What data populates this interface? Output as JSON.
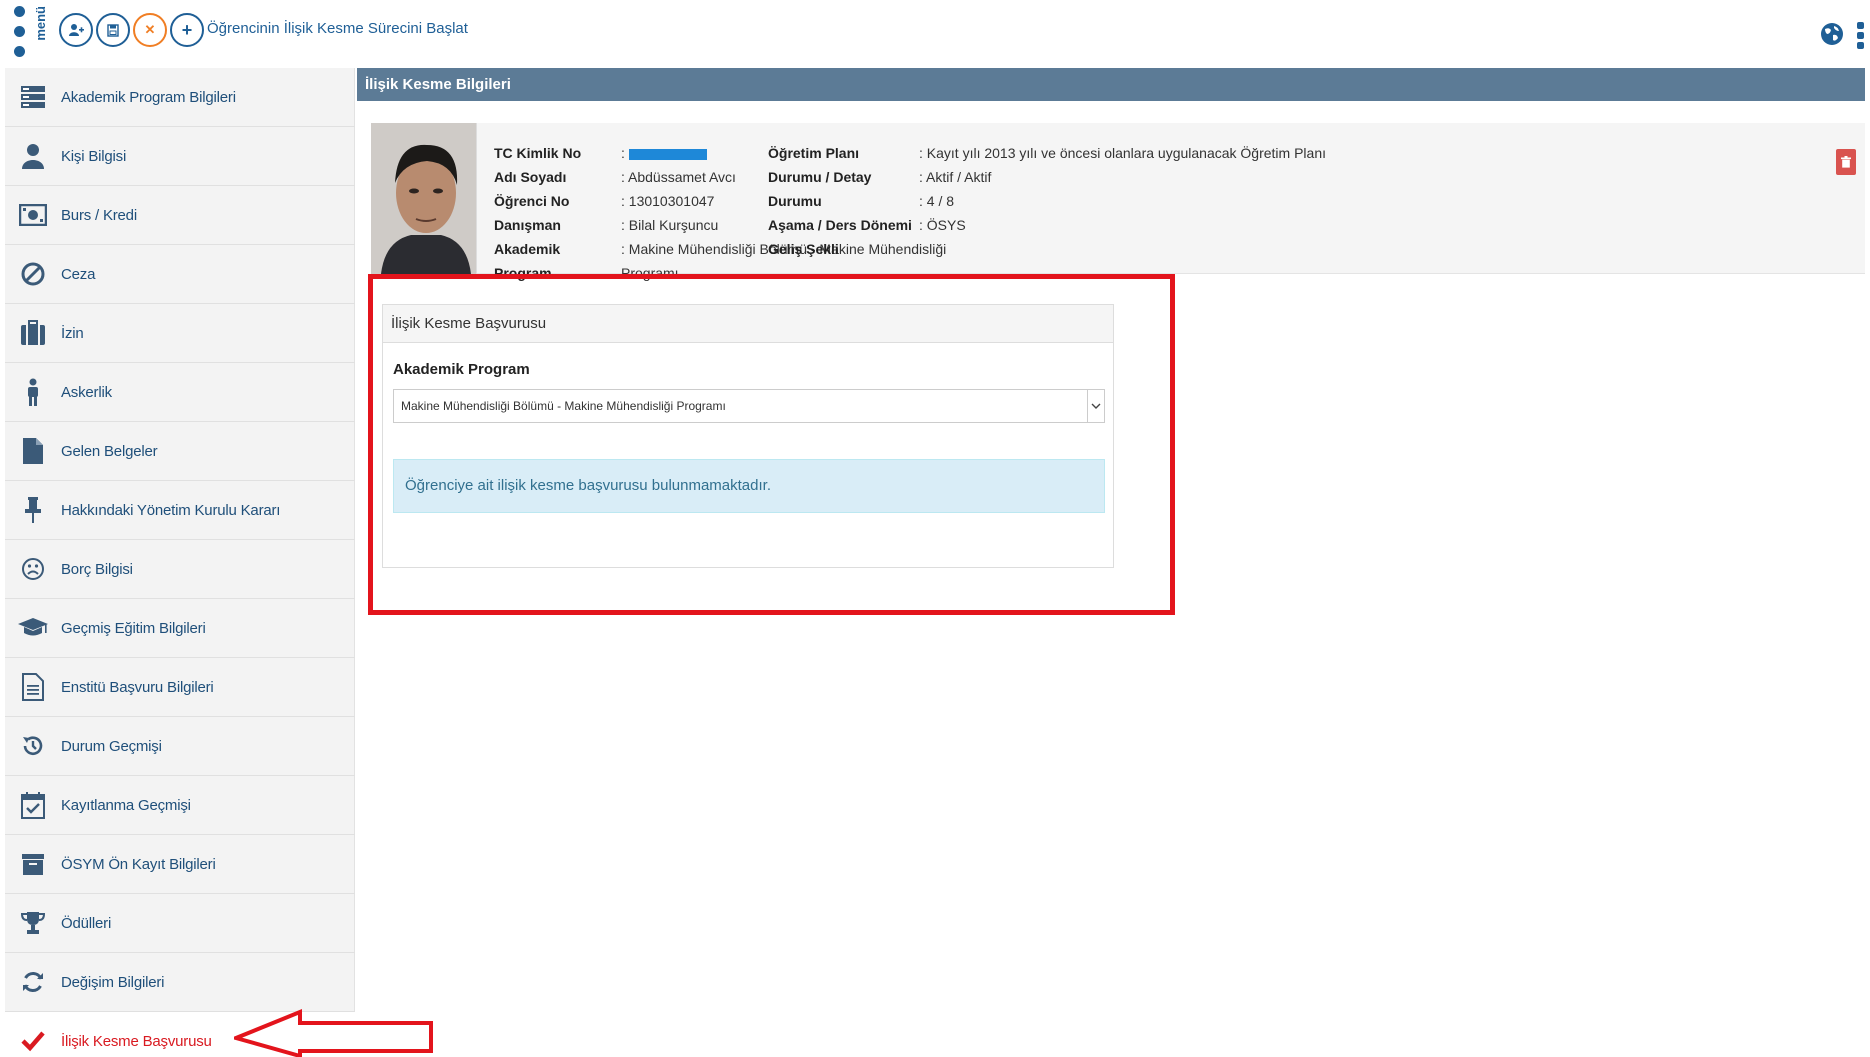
{
  "topbar": {
    "menu_word": "menü",
    "action_label": "Öğrencinin İlişik Kesme Sürecini Başlat",
    "buttons": [
      {
        "icon": "add-user-icon"
      },
      {
        "icon": "save-icon"
      },
      {
        "icon": "close-icon"
      },
      {
        "icon": "plus-icon"
      }
    ]
  },
  "sidebar": {
    "items": [
      {
        "label": "Akademik Program Bilgileri",
        "icon": "program-icon"
      },
      {
        "label": "Kişi Bilgisi",
        "icon": "person-icon"
      },
      {
        "label": "Burs / Kredi",
        "icon": "money-icon"
      },
      {
        "label": "Ceza",
        "icon": "ban-icon"
      },
      {
        "label": "İzin",
        "icon": "suitcase-icon"
      },
      {
        "label": "Askerlik",
        "icon": "soldier-icon"
      },
      {
        "label": "Gelen Belgeler",
        "icon": "file-icon"
      },
      {
        "label": "Hakkındaki Yönetim Kurulu Kararı",
        "icon": "pin-icon"
      },
      {
        "label": "Borç Bilgisi",
        "icon": "frown-icon"
      },
      {
        "label": "Geçmiş Eğitim Bilgileri",
        "icon": "graduation-cap-icon"
      },
      {
        "label": "Enstitü Başvuru Bilgileri",
        "icon": "document-icon"
      },
      {
        "label": "Durum Geçmişi",
        "icon": "history-icon"
      },
      {
        "label": "Kayıtlanma Geçmişi",
        "icon": "calendar-check-icon"
      },
      {
        "label": "ÖSYM Ön Kayıt Bilgileri",
        "icon": "archive-icon"
      },
      {
        "label": "Ödülleri",
        "icon": "trophy-icon"
      },
      {
        "label": "Değişim Bilgileri",
        "icon": "refresh-icon"
      },
      {
        "label": "İlişik Kesme Başvurusu",
        "icon": "check-icon",
        "active": true
      }
    ]
  },
  "main": {
    "header": "İlişik Kesme Bilgileri",
    "student": {
      "col1": [
        {
          "key": "TC Kimlik No",
          "value": ": "
        },
        {
          "key": "Adı Soyadı",
          "value": ": Abdüssamet Avcı"
        },
        {
          "key": "Öğrenci No",
          "value": ": 13010301047"
        },
        {
          "key": "Danışman",
          "value": ": Bilal Kurşuncu"
        },
        {
          "key": "Akademik Program",
          "value": ": Makine Mühendisliği Bölümü - Makine Mühendisliği Programı"
        }
      ],
      "col2": [
        {
          "key": "Öğretim Planı",
          "value": ": Kayıt yılı 2013 yılı ve öncesi olanlara uygulanacak Öğretim Planı"
        },
        {
          "key": "Durumu / Detay Durumu",
          "value": ": Aktif / Aktif"
        },
        {
          "key": "Aşama / Ders Dönemi",
          "value": ": 4 / 8"
        },
        {
          "key": "Geliş Şekli",
          "value": ": ÖSYS"
        }
      ]
    },
    "panel": {
      "title": "İlişik Kesme Başvurusu",
      "field_label": "Akademik Program",
      "select_value": "Makine Mühendisliği Bölümü - Makine Mühendisliği Programı",
      "alert": "Öğrenciye ait ilişik kesme başvurusu bulunmamaktadır."
    },
    "colors": {
      "brand": "#1f5f96",
      "header": "#5c7b96",
      "highlight": "#e3141c",
      "alert_bg": "#d9edf7"
    }
  }
}
